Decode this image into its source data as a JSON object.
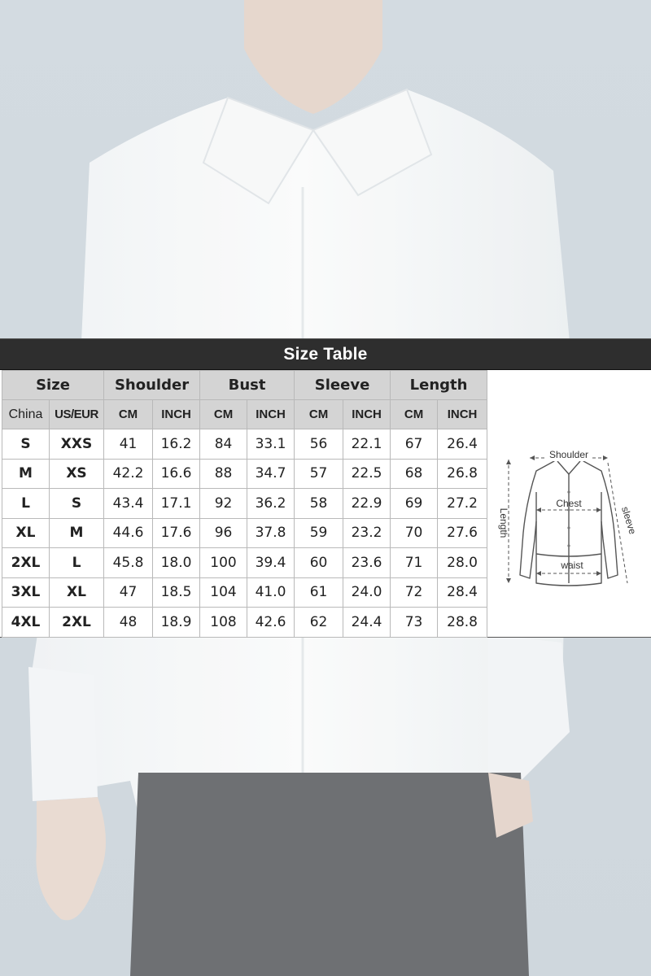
{
  "table": {
    "title": "Size Table",
    "groups": [
      "Size",
      "Shoulder",
      "Bust",
      "Sleeve",
      "Length"
    ],
    "subheaders": [
      "China",
      "US/EUR",
      "CM",
      "INCH",
      "CM",
      "INCH",
      "CM",
      "INCH",
      "CM",
      "INCH"
    ],
    "rows": [
      [
        "S",
        "XXS",
        "41",
        "16.2",
        "84",
        "33.1",
        "56",
        "22.1",
        "67",
        "26.4"
      ],
      [
        "M",
        "XS",
        "42.2",
        "16.6",
        "88",
        "34.7",
        "57",
        "22.5",
        "68",
        "26.8"
      ],
      [
        "L",
        "S",
        "43.4",
        "17.1",
        "92",
        "36.2",
        "58",
        "22.9",
        "69",
        "27.2"
      ],
      [
        "XL",
        "M",
        "44.6",
        "17.6",
        "96",
        "37.8",
        "59",
        "23.2",
        "70",
        "27.6"
      ],
      [
        "2XL",
        "L",
        "45.8",
        "18.0",
        "100",
        "39.4",
        "60",
        "23.6",
        "71",
        "28.0"
      ],
      [
        "3XL",
        "XL",
        "47",
        "18.5",
        "104",
        "41.0",
        "61",
        "24.0",
        "72",
        "28.4"
      ],
      [
        "4XL",
        "2XL",
        "48",
        "18.9",
        "108",
        "42.6",
        "62",
        "24.4",
        "73",
        "28.8"
      ]
    ]
  },
  "diagram": {
    "shoulder": "Shoulder",
    "chest": "Chest",
    "length": "Length",
    "sleeve": "sleeve",
    "waist": "waist"
  },
  "colors": {
    "header_bg": "#2e2e2e",
    "header_row_bg": "#d4d4d4",
    "us_size_text": "#cc1111",
    "background": "#ccd5dc"
  }
}
